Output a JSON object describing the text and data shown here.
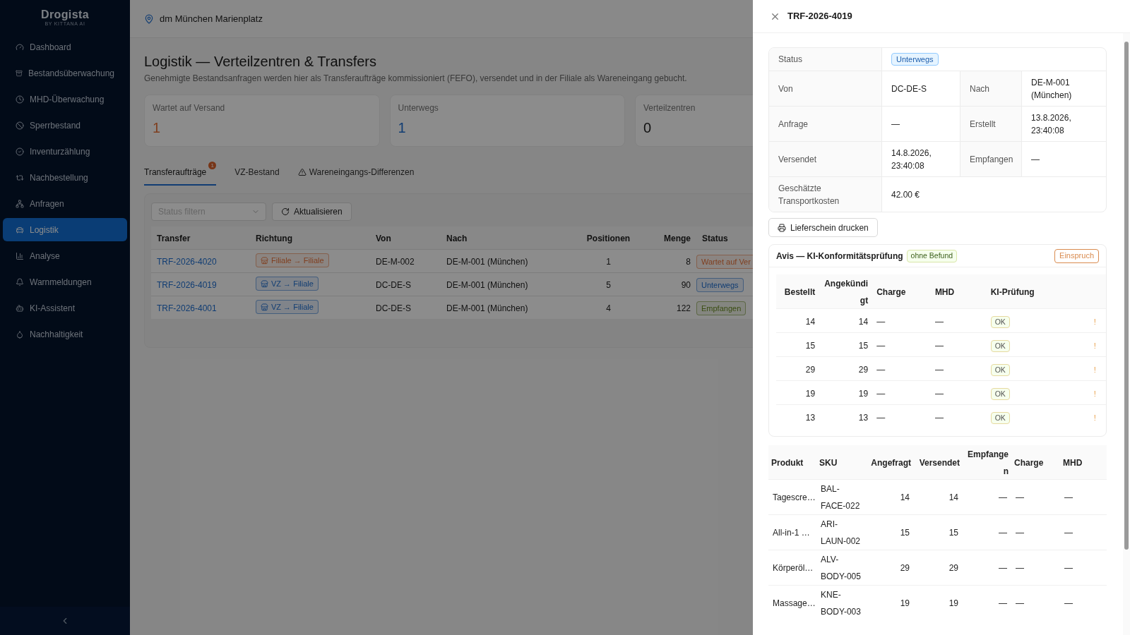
{
  "sidebar": {
    "logo": "Drogista",
    "logo_sub": "BY KITTANA AI",
    "items": [
      {
        "label": "Dashboard",
        "selected": false
      },
      {
        "label": "Bestandsüberwachung",
        "selected": false
      },
      {
        "label": "MHD-Überwachung",
        "selected": false
      },
      {
        "label": "Sperrbestand",
        "selected": false
      },
      {
        "label": "Inventurzählung",
        "selected": false
      },
      {
        "label": "Nachbestellung",
        "selected": false
      },
      {
        "label": "Anfragen",
        "selected": false
      },
      {
        "label": "Logistik",
        "selected": true
      },
      {
        "label": "Analyse",
        "selected": false
      },
      {
        "label": "Warnmeldungen",
        "selected": false
      },
      {
        "label": "KI-Assistent",
        "selected": false
      },
      {
        "label": "Nachhaltigkeit",
        "selected": false
      }
    ]
  },
  "header": {
    "store": "dm München Marienplatz"
  },
  "page": {
    "title": "Logistik — Verteilzentren & Transfers",
    "subtitle": "Genehmigte Bestandsanfragen werden hier als Transferaufträge kommissioniert (FEFO), versendet und in der Filiale als Wareneingang gebucht."
  },
  "stats": [
    {
      "label": "Wartet auf Versand",
      "value": "1",
      "kind": "warning"
    },
    {
      "label": "Unterwegs",
      "value": "1",
      "kind": "info"
    },
    {
      "label": "Verteilzentren",
      "value": "0",
      "kind": "neutral"
    }
  ],
  "tabs": [
    {
      "label": "Transferaufträge",
      "selected": true,
      "kind": "badge",
      "badge": "1"
    },
    {
      "label": "VZ-Bestand",
      "selected": false,
      "kind": "plain"
    },
    {
      "label": "Wareneingangs-Differenzen",
      "selected": false,
      "kind": "warning"
    }
  ],
  "filter": {
    "placeholder": "Status filtern"
  },
  "refresh_button": "Aktualisieren",
  "table": {
    "columns": [
      "Transfer",
      "Richtung",
      "Von",
      "Nach",
      "Positionen",
      "Menge",
      "Status"
    ],
    "rows": [
      {
        "transfer": "TRF-2026-4020",
        "direction": {
          "label": "Filiale → Filiale",
          "kind": "warning"
        },
        "von": "DE-M-002",
        "nach": "DE-M-001 (München)",
        "positionen": "1",
        "menge": "8",
        "status": {
          "label": "Wartet auf Ver",
          "kind": "warning"
        }
      },
      {
        "transfer": "TRF-2026-4019",
        "direction": {
          "label": "VZ → Filiale",
          "kind": "info"
        },
        "von": "DC-DE-S",
        "nach": "DE-M-001 (München)",
        "positionen": "5",
        "menge": "90",
        "status": {
          "label": "Unterwegs",
          "kind": "info"
        }
      },
      {
        "transfer": "TRF-2026-4001",
        "direction": {
          "label": "VZ → Filiale",
          "kind": "info"
        },
        "von": "DC-DE-S",
        "nach": "DE-M-001 (München)",
        "positionen": "4",
        "menge": "122",
        "status": {
          "label": "Empfangen",
          "kind": "success"
        }
      }
    ]
  },
  "drawer": {
    "title": "TRF-2026-4019",
    "details": [
      [
        {
          "label": "Status",
          "value": "Unterwegs",
          "kind": "badge"
        }
      ],
      [
        {
          "label": "Von",
          "value": "DC-DE-S",
          "kind": "text"
        },
        {
          "label": "Nach",
          "value": "DE-M-001 (München)",
          "kind": "text"
        }
      ],
      [
        {
          "label": "Anfrage",
          "value": "—",
          "kind": "text"
        },
        {
          "label": "Erstellt",
          "value": "13.8.2026, 23:40:08",
          "kind": "text"
        }
      ],
      [
        {
          "label": "Versendet",
          "value": "14.8.2026, 23:40:08",
          "kind": "text"
        },
        {
          "label": "Empfangen",
          "value": "—",
          "kind": "text"
        }
      ],
      [
        {
          "label": "Geschätzte Transportkosten",
          "value": "42.00 €",
          "kind": "text"
        }
      ]
    ],
    "print_button": "Lieferschein drucken",
    "avis": {
      "title": "Avis — KI-Konformitätsprüfung",
      "badge": "ohne Befund",
      "action": "Einspruch",
      "columns": [
        "Bestellt",
        "Angekündigt",
        "Charge",
        "MHD",
        "KI-Prüfung"
      ],
      "rows": [
        {
          "bestellt": "14",
          "angekuendigt": "14",
          "charge": "—",
          "mhd": "—",
          "check": "OK",
          "flag": "!"
        },
        {
          "bestellt": "15",
          "angekuendigt": "15",
          "charge": "—",
          "mhd": "—",
          "check": "OK",
          "flag": "!"
        },
        {
          "bestellt": "29",
          "angekuendigt": "29",
          "charge": "—",
          "mhd": "—",
          "check": "OK",
          "flag": "!"
        },
        {
          "bestellt": "19",
          "angekuendigt": "19",
          "charge": "—",
          "mhd": "—",
          "check": "OK",
          "flag": "!"
        },
        {
          "bestellt": "13",
          "angekuendigt": "13",
          "charge": "—",
          "mhd": "—",
          "check": "OK",
          "flag": "!"
        }
      ]
    },
    "products": {
      "columns": [
        "Produkt",
        "SKU",
        "Angefragt",
        "Versendet",
        "Empfangen",
        "Charge",
        "MHD"
      ],
      "rows": [
        {
          "produkt": "Tagescre…",
          "sku": "BAL-FACE-022",
          "angefragt": "14",
          "versendet": "14",
          "empfangen": "—",
          "charge": "—",
          "mhd": "—"
        },
        {
          "produkt": "All-in-1 …",
          "sku": "ARI-LAUN-002",
          "angefragt": "15",
          "versendet": "15",
          "empfangen": "—",
          "charge": "—",
          "mhd": "—"
        },
        {
          "produkt": "Körperöl…",
          "sku": "ALV-BODY-005",
          "angefragt": "29",
          "versendet": "29",
          "empfangen": "—",
          "charge": "—",
          "mhd": "—"
        },
        {
          "produkt": "Massage…",
          "sku": "KNE-BODY-003",
          "angefragt": "19",
          "versendet": "19",
          "empfangen": "—",
          "charge": "—",
          "mhd": "—"
        }
      ]
    }
  }
}
